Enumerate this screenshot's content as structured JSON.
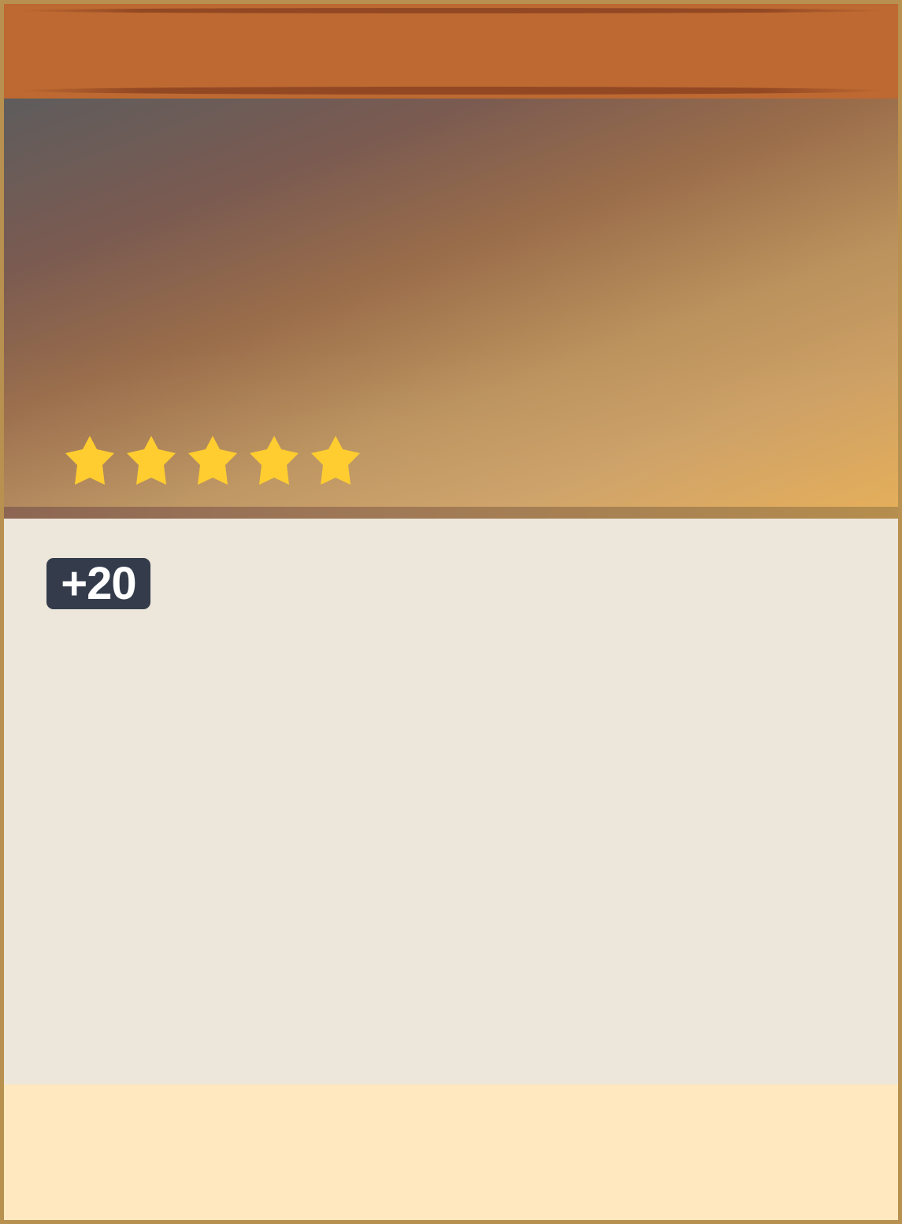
{
  "card": {
    "rarity_stars": 5,
    "cost_label": "+20"
  },
  "icons": {
    "star": "star-icon"
  },
  "colors": {
    "border": "#b8904f",
    "header": "#bd6931",
    "star": "#ffcd2f",
    "badge": "#343c4b",
    "panel": "#ede6da",
    "footer": "#ffe8bf"
  }
}
